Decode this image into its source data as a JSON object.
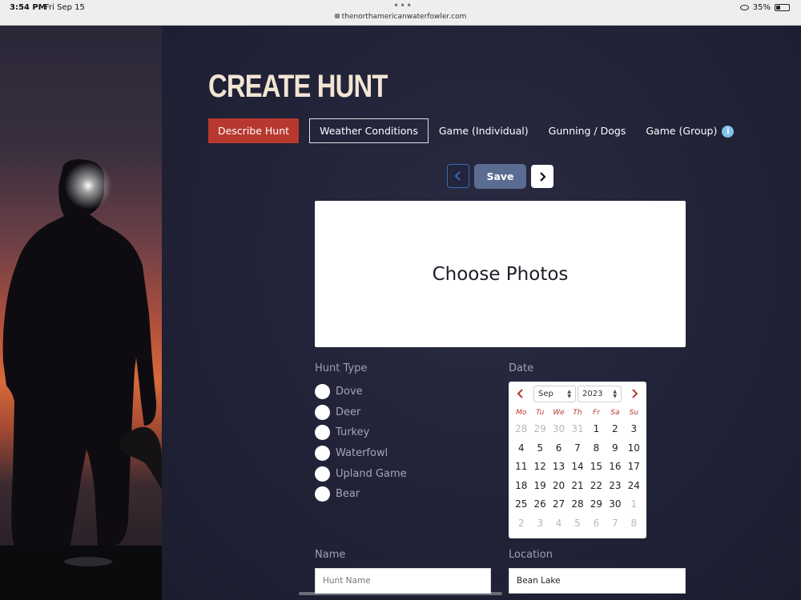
{
  "status_bar": {
    "time": "3:54 PM",
    "date": "Fri Sep 15",
    "url": "thenorthamericanwaterfowler.com",
    "battery": "35%",
    "battery_level": 0.35
  },
  "page": {
    "title": "CREATE HUNT"
  },
  "tabs": [
    {
      "label": "Describe Hunt"
    },
    {
      "label": "Weather Conditions"
    },
    {
      "label": "Game (Individual)"
    },
    {
      "label": "Gunning / Dogs"
    },
    {
      "label": "Game (Group)"
    }
  ],
  "toolbar": {
    "save_label": "Save"
  },
  "photos": {
    "label": "Choose Photos"
  },
  "hunt_type": {
    "label": "Hunt Type",
    "options": [
      "Dove",
      "Deer",
      "Turkey",
      "Waterfowl",
      "Upland Game",
      "Bear"
    ]
  },
  "date": {
    "label": "Date",
    "month": "Sep",
    "year": "2023",
    "weekdays": [
      "Mo",
      "Tu",
      "We",
      "Th",
      "Fr",
      "Sa",
      "Su"
    ],
    "days": [
      {
        "d": "28",
        "muted": true
      },
      {
        "d": "29",
        "muted": true
      },
      {
        "d": "30",
        "muted": true
      },
      {
        "d": "31",
        "muted": true
      },
      {
        "d": "1"
      },
      {
        "d": "2"
      },
      {
        "d": "3"
      },
      {
        "d": "4"
      },
      {
        "d": "5"
      },
      {
        "d": "6"
      },
      {
        "d": "7"
      },
      {
        "d": "8"
      },
      {
        "d": "9"
      },
      {
        "d": "10"
      },
      {
        "d": "11"
      },
      {
        "d": "12"
      },
      {
        "d": "13"
      },
      {
        "d": "14"
      },
      {
        "d": "15"
      },
      {
        "d": "16"
      },
      {
        "d": "17"
      },
      {
        "d": "18"
      },
      {
        "d": "19"
      },
      {
        "d": "20"
      },
      {
        "d": "21"
      },
      {
        "d": "22"
      },
      {
        "d": "23"
      },
      {
        "d": "24"
      },
      {
        "d": "25"
      },
      {
        "d": "26"
      },
      {
        "d": "27"
      },
      {
        "d": "28"
      },
      {
        "d": "29"
      },
      {
        "d": "30"
      },
      {
        "d": "1",
        "muted": true
      },
      {
        "d": "2",
        "muted": true
      },
      {
        "d": "3",
        "muted": true
      },
      {
        "d": "4",
        "muted": true
      },
      {
        "d": "5",
        "muted": true
      },
      {
        "d": "6",
        "muted": true
      },
      {
        "d": "7",
        "muted": true
      },
      {
        "d": "8",
        "muted": true
      }
    ]
  },
  "name": {
    "label": "Name",
    "placeholder": "Hunt Name",
    "value": ""
  },
  "location": {
    "label": "Location",
    "value": "Bean Lake"
  },
  "colors": {
    "accent": "#b7382e",
    "save_button": "#5a6c92",
    "title": "#f1e4d3",
    "info": "#7fc3ea"
  }
}
